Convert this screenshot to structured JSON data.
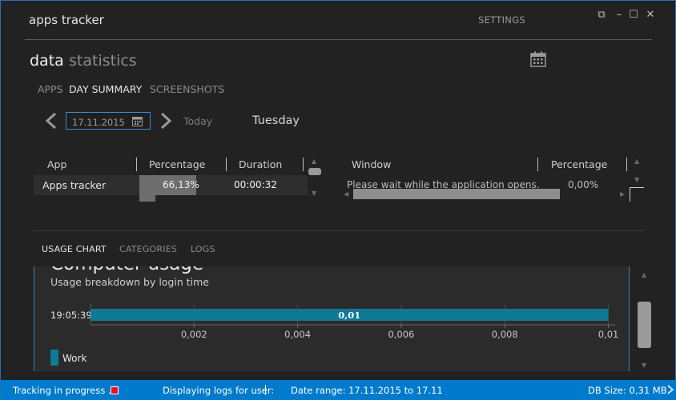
{
  "window": {
    "title": "apps tracker",
    "settings_label": "SETTINGS",
    "controls": {
      "restore": "⧉",
      "minimize": "–",
      "maximize": "☐",
      "close": "✕"
    }
  },
  "header": {
    "primary": "data",
    "secondary": "statistics",
    "calendar_icon": "calendar-icon"
  },
  "subtabs": [
    {
      "label": "APPS",
      "active": false
    },
    {
      "label": "DAY SUMMARY",
      "active": true
    },
    {
      "label": "SCREENSHOTS",
      "active": false
    }
  ],
  "date_nav": {
    "date_value": "17.11.2015",
    "today_label": "Today",
    "day_name": "Tuesday"
  },
  "apps_grid": {
    "columns": [
      "App",
      "Percentage",
      "Duration"
    ],
    "rows": [
      {
        "app": "Apps tracker",
        "percentage": "66,13%",
        "percentage_value": 66.13,
        "duration": "00:00:32"
      }
    ]
  },
  "windows_grid": {
    "columns": [
      "Window",
      "Percentage"
    ],
    "rows": [
      {
        "window": "Please wait while the application opens...",
        "percentage": "0,00%"
      }
    ]
  },
  "bottom_tabs": [
    {
      "label": "USAGE CHART",
      "active": true
    },
    {
      "label": "CATEGORIES",
      "active": false
    },
    {
      "label": "LOGS",
      "active": false
    }
  ],
  "chart_data": {
    "type": "bar",
    "orientation": "horizontal",
    "title": "Computer usage",
    "subtitle": "Usage breakdown by login time",
    "categories": [
      "19:05:39"
    ],
    "series": [
      {
        "name": "Work",
        "values": [
          0.01
        ],
        "color": "#0e7a94"
      }
    ],
    "data_labels": [
      "0,01"
    ],
    "x_ticks": [
      0.002,
      0.004,
      0.006,
      0.008,
      0.01
    ],
    "x_tick_labels": [
      "0,002",
      "0,004",
      "0,006",
      "0,008",
      "0,01"
    ],
    "xlim": [
      0,
      0.0101
    ],
    "grid": true,
    "legend": "bottom-left"
  },
  "status": {
    "tracking": "Tracking in progress ...",
    "tracking_color": "#e81123",
    "user": "Displaying logs for user:",
    "range": "Date range: 17.11.2015 to 17.11",
    "db_size": "DB Size: 0,31 MB",
    "bar_color": "#007acc"
  },
  "colors": {
    "accent": "#2d86d8",
    "bar": "#0e7a94"
  }
}
